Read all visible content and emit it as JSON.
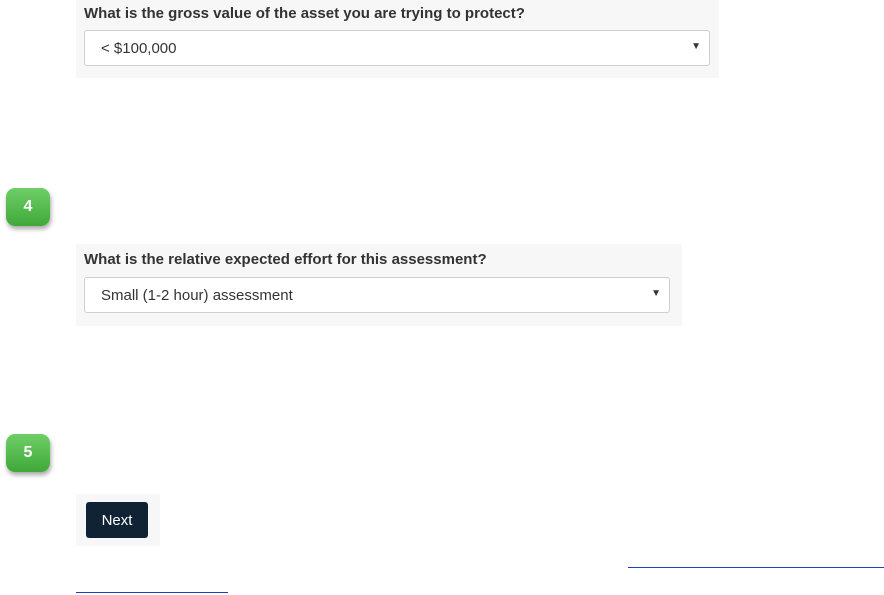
{
  "questions": [
    {
      "label": "What is the gross value of the asset you are trying to protect?",
      "selected": "< $100,000"
    },
    {
      "label": "What is the relative expected effort for this assessment?",
      "selected": "Small (1-2 hour) assessment"
    }
  ],
  "steps": {
    "badge_4": "4",
    "badge_5": "5"
  },
  "next_button": {
    "label": "Next"
  },
  "icons": {
    "dropdown_arrow": "▼"
  },
  "colors": {
    "badge_green": "#4cb847",
    "button_dark": "#0f2335",
    "link_blue": "#1a3fbf"
  }
}
